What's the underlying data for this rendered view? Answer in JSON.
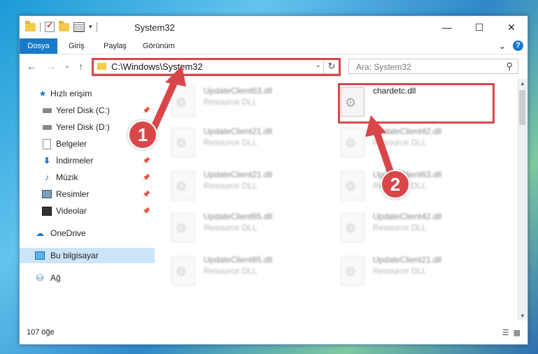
{
  "window": {
    "title": "System32",
    "controls": {
      "minimize": "—",
      "maximize": "☐",
      "close": "✕"
    }
  },
  "ribbon": {
    "tabs": [
      "Dosya",
      "Giriş",
      "Paylaş",
      "Görünüm"
    ],
    "expand": "⌄",
    "help": "?"
  },
  "nav": {
    "back": "←",
    "forward": "→",
    "recent": "⌄",
    "up": "↑"
  },
  "address": {
    "path": "C:\\Windows\\System32",
    "chevron": "⌄",
    "refresh": "↻"
  },
  "search": {
    "placeholder": "Ara: System32",
    "icon": "⚲"
  },
  "sidebar": {
    "items": [
      {
        "label": "Hızlı erişim",
        "icon": "star-icon"
      },
      {
        "label": "Yerel Disk (C:)",
        "icon": "drive-icon",
        "pinned": true
      },
      {
        "label": "Yerel Disk (D:)",
        "icon": "drive-icon",
        "pinned": true
      },
      {
        "label": "Belgeler",
        "icon": "document-icon",
        "pinned": false
      },
      {
        "label": "İndirmeler",
        "icon": "download-icon",
        "pinned": true
      },
      {
        "label": "Müzik",
        "icon": "music-icon",
        "pinned": true
      },
      {
        "label": "Resimler",
        "icon": "picture-icon",
        "pinned": true
      },
      {
        "label": "Videolar",
        "icon": "video-icon",
        "pinned": true
      },
      {
        "label": "OneDrive",
        "icon": "cloud-icon"
      },
      {
        "label": "Bu bilgisayar",
        "icon": "computer-icon",
        "selected": true
      },
      {
        "label": "Ağ",
        "icon": "network-icon"
      }
    ],
    "pin_glyph": "📌"
  },
  "files": [
    {
      "name": "UpdateClient63.dll",
      "type": "Resource DLL",
      "blurred": true
    },
    {
      "name": "chardetc.dll",
      "type": "",
      "blurred": false,
      "highlighted": true
    },
    {
      "name": "UpdateClient21.dll",
      "type": "Resource DLL",
      "blurred": true
    },
    {
      "name": "UpdateClient42.dll",
      "type": "Resource DLL",
      "blurred": true
    },
    {
      "name": "UpdateClient21.dll",
      "type": "Resource DLL",
      "blurred": true
    },
    {
      "name": "UpdateClient63.dll",
      "type": "Resource DLL",
      "blurred": true
    },
    {
      "name": "UpdateClient65.dll",
      "type": "Resource DLL",
      "blurred": true
    },
    {
      "name": "UpdateClient42.dll",
      "type": "Resource DLL",
      "blurred": true
    },
    {
      "name": "UpdateClient65.dll",
      "type": "Resource DLL",
      "blurred": true
    },
    {
      "name": "UpdateClient21.dll",
      "type": "Resource DLL",
      "blurred": true
    }
  ],
  "status": {
    "count": "107 öğe",
    "view_details": "☰",
    "view_icons": "▦"
  },
  "annotations": {
    "step1": "1",
    "step2": "2",
    "color": "#d9464a"
  }
}
